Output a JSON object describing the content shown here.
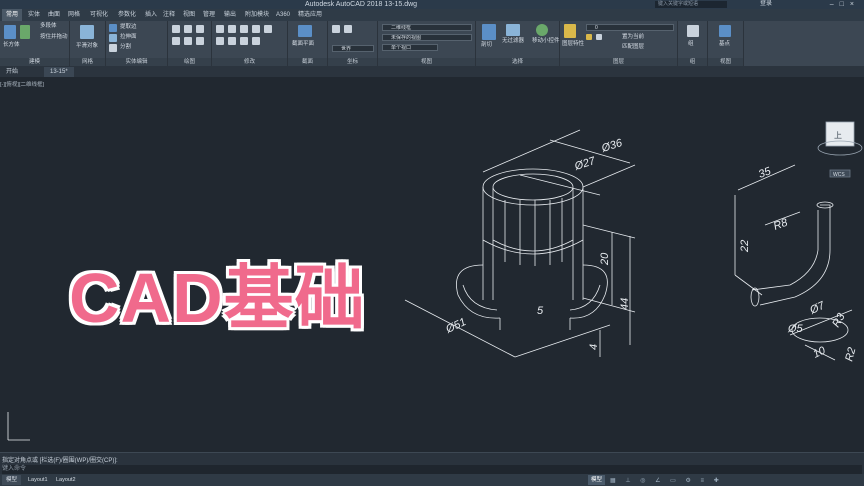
{
  "window": {
    "title": "Autodesk AutoCAD 2018    13-15.dwg",
    "search_placeholder": "键入关键字或短语",
    "user": "登录"
  },
  "ribbon_tabs": [
    "常用",
    "实体",
    "曲面",
    "网格",
    "可视化",
    "参数化",
    "插入",
    "注释",
    "视图",
    "管理",
    "输出",
    "附加模块",
    "A360",
    "精选应用"
  ],
  "ribbon": {
    "panels": [
      {
        "title": "建模",
        "items": [
          "长方体",
          "拉伸",
          "多段体",
          "按住并拖动"
        ]
      },
      {
        "title": "网格",
        "items": [
          "平滑对象"
        ]
      },
      {
        "title": "实体编辑",
        "items": [
          "提取边",
          "拉伸面",
          "分割"
        ]
      },
      {
        "title": "绘图",
        "items": []
      },
      {
        "title": "修改",
        "items": []
      },
      {
        "title": "截面",
        "items": [
          "截面平面"
        ]
      },
      {
        "title": "坐标",
        "items": [
          "世界"
        ]
      },
      {
        "title": "视图",
        "items": [
          "二维线框",
          "未保存的视图",
          "单个视口"
        ]
      },
      {
        "title": "选择",
        "items": [
          "剖切",
          "无过滤器",
          "移动小控件"
        ]
      },
      {
        "title": "图层",
        "items": [
          "图层特性",
          "置为当前",
          "匹配图层"
        ]
      },
      {
        "title": "组",
        "items": [
          "组"
        ]
      },
      {
        "title": "视图",
        "items": [
          "基点"
        ]
      }
    ],
    "layer_value": "0"
  },
  "file_tabs": [
    "开始",
    "13-15*"
  ],
  "viewport_label": "[-][俯视][二维线框]",
  "viewcube": {
    "face": "上",
    "compass": "WCS"
  },
  "drawing": {
    "left_part": {
      "dims": [
        "Ø36",
        "Ø27",
        "20",
        "44",
        "Ø51",
        "5",
        "4"
      ]
    },
    "right_part": {
      "dims": [
        "35",
        "R8",
        "22",
        "Ø7",
        "R3",
        "Ø5",
        "10",
        "R2"
      ]
    }
  },
  "overlay_text": "CAD基础",
  "command_line": {
    "history": "指定对角点或 [栏选(F)/圈围(WP)/圈交(CP)]:",
    "prompt": "键入命令"
  },
  "status": {
    "layouts": [
      "模型",
      "Layout1",
      "Layout2"
    ],
    "space": "模型"
  },
  "colors": {
    "background": "#212830",
    "overlay": "#f06a8c",
    "linework": "#e8ecf0"
  }
}
